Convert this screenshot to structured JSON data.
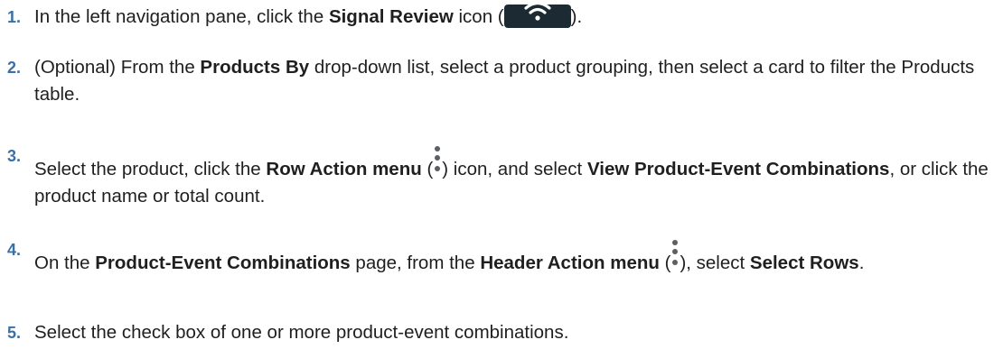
{
  "steps": [
    {
      "number": "1.",
      "parts": {
        "t1": "In the left navigation pane, click the ",
        "b1": "Signal Review",
        "t2": " icon (",
        "icon": "wifi-signal-icon",
        "t3": ")."
      }
    },
    {
      "number": "2.",
      "parts": {
        "t1": "(Optional) From the ",
        "b1": "Products By",
        "t2": " drop-down list, select a product grouping, then select a card to filter the Products table."
      }
    },
    {
      "number": "3.",
      "parts": {
        "t1": "Select the product, click the ",
        "b1": "Row Action menu",
        "t2": " (",
        "icon": "kebab-menu-icon",
        "t3": ") icon, and select ",
        "b2": "View Product-Event Combinations",
        "t4": ", or click the product name or total count."
      }
    },
    {
      "number": "4.",
      "parts": {
        "t1": "On the ",
        "b1": "Product-Event Combinations",
        "t2": " page, from the ",
        "b2": "Header Action menu",
        "t3": " (",
        "icon": "kebab-menu-icon",
        "t4": "), select ",
        "b3": "Select Rows",
        "t5": "."
      }
    },
    {
      "number": "5.",
      "parts": {
        "t1": "Select the check box of one or more product-event combinations."
      }
    }
  ],
  "colors": {
    "step_number": "#3a6fa7",
    "signal_icon_bg": "#1c2b33",
    "kebab_icon": "#5b5f63"
  }
}
